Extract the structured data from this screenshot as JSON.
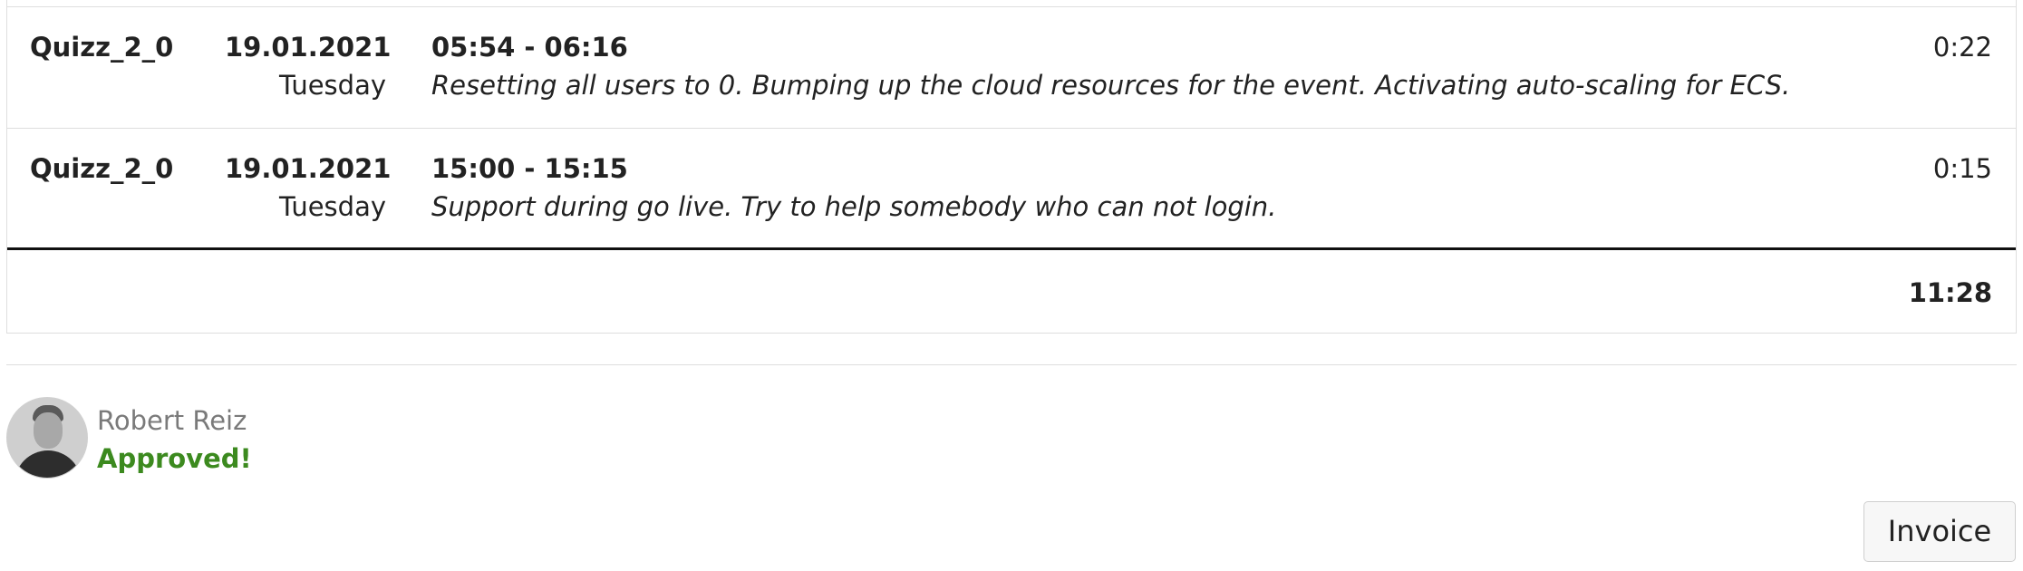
{
  "entries": [
    {
      "project": "Quizz_2_0",
      "date": "19.01.2021",
      "weekday": "Tuesday",
      "time_range": "05:54 - 06:16",
      "description": "Resetting all users to 0. Bumping up the cloud resources for the event. Activating auto-scaling for ECS.",
      "duration": "0:22"
    },
    {
      "project": "Quizz_2_0",
      "date": "19.01.2021",
      "weekday": "Tuesday",
      "time_range": "15:00 - 15:15",
      "description": "Support during go live. Try to help somebody who can not login.",
      "duration": "0:15"
    }
  ],
  "total_duration": "11:28",
  "approval": {
    "approver_name": "Robert Reiz",
    "status": "Approved!",
    "status_color": "#3c8a1f"
  },
  "actions": {
    "invoice_label": "Invoice"
  }
}
